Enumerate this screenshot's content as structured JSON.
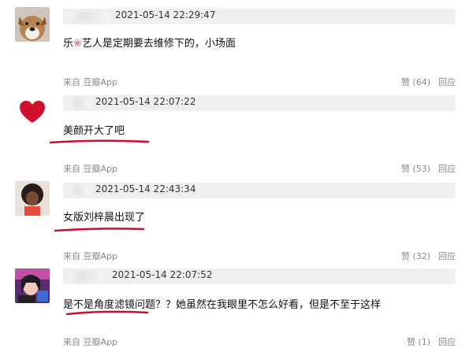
{
  "comments": [
    {
      "avatar": "dog-avatar",
      "timestamp": "2021-05-14 22:29:47",
      "text_before": "乐",
      "flower": "❀",
      "text_after": "艺人是定期要去维修下的，小场面",
      "source": "来自 豆瓣App",
      "likes": "赞 (64)",
      "reply": "回应"
    },
    {
      "avatar": "heart-avatar",
      "timestamp": "2021-05-14 22:07:22",
      "text": "美颜开大了吧",
      "source": "来自 豆瓣App",
      "likes": "赞 (53)",
      "reply": "回应"
    },
    {
      "avatar": "person-avatar",
      "timestamp": "2021-05-14 22:43:34",
      "text": "女版刘梓晨出现了",
      "source": "来自 豆瓣App",
      "likes": "赞 (32)",
      "reply": "回应"
    },
    {
      "avatar": "girl-avatar",
      "timestamp": "2021-05-14 22:07:52",
      "text": "是不是角度滤镜问题？？她虽然在我眼里不怎么好看，但是不至于这样",
      "source": "来自 豆瓣App",
      "likes": "赞 (1)",
      "reply": "回应"
    }
  ],
  "colors": {
    "underline": "#c8102e",
    "bar": "#eef0ee"
  }
}
